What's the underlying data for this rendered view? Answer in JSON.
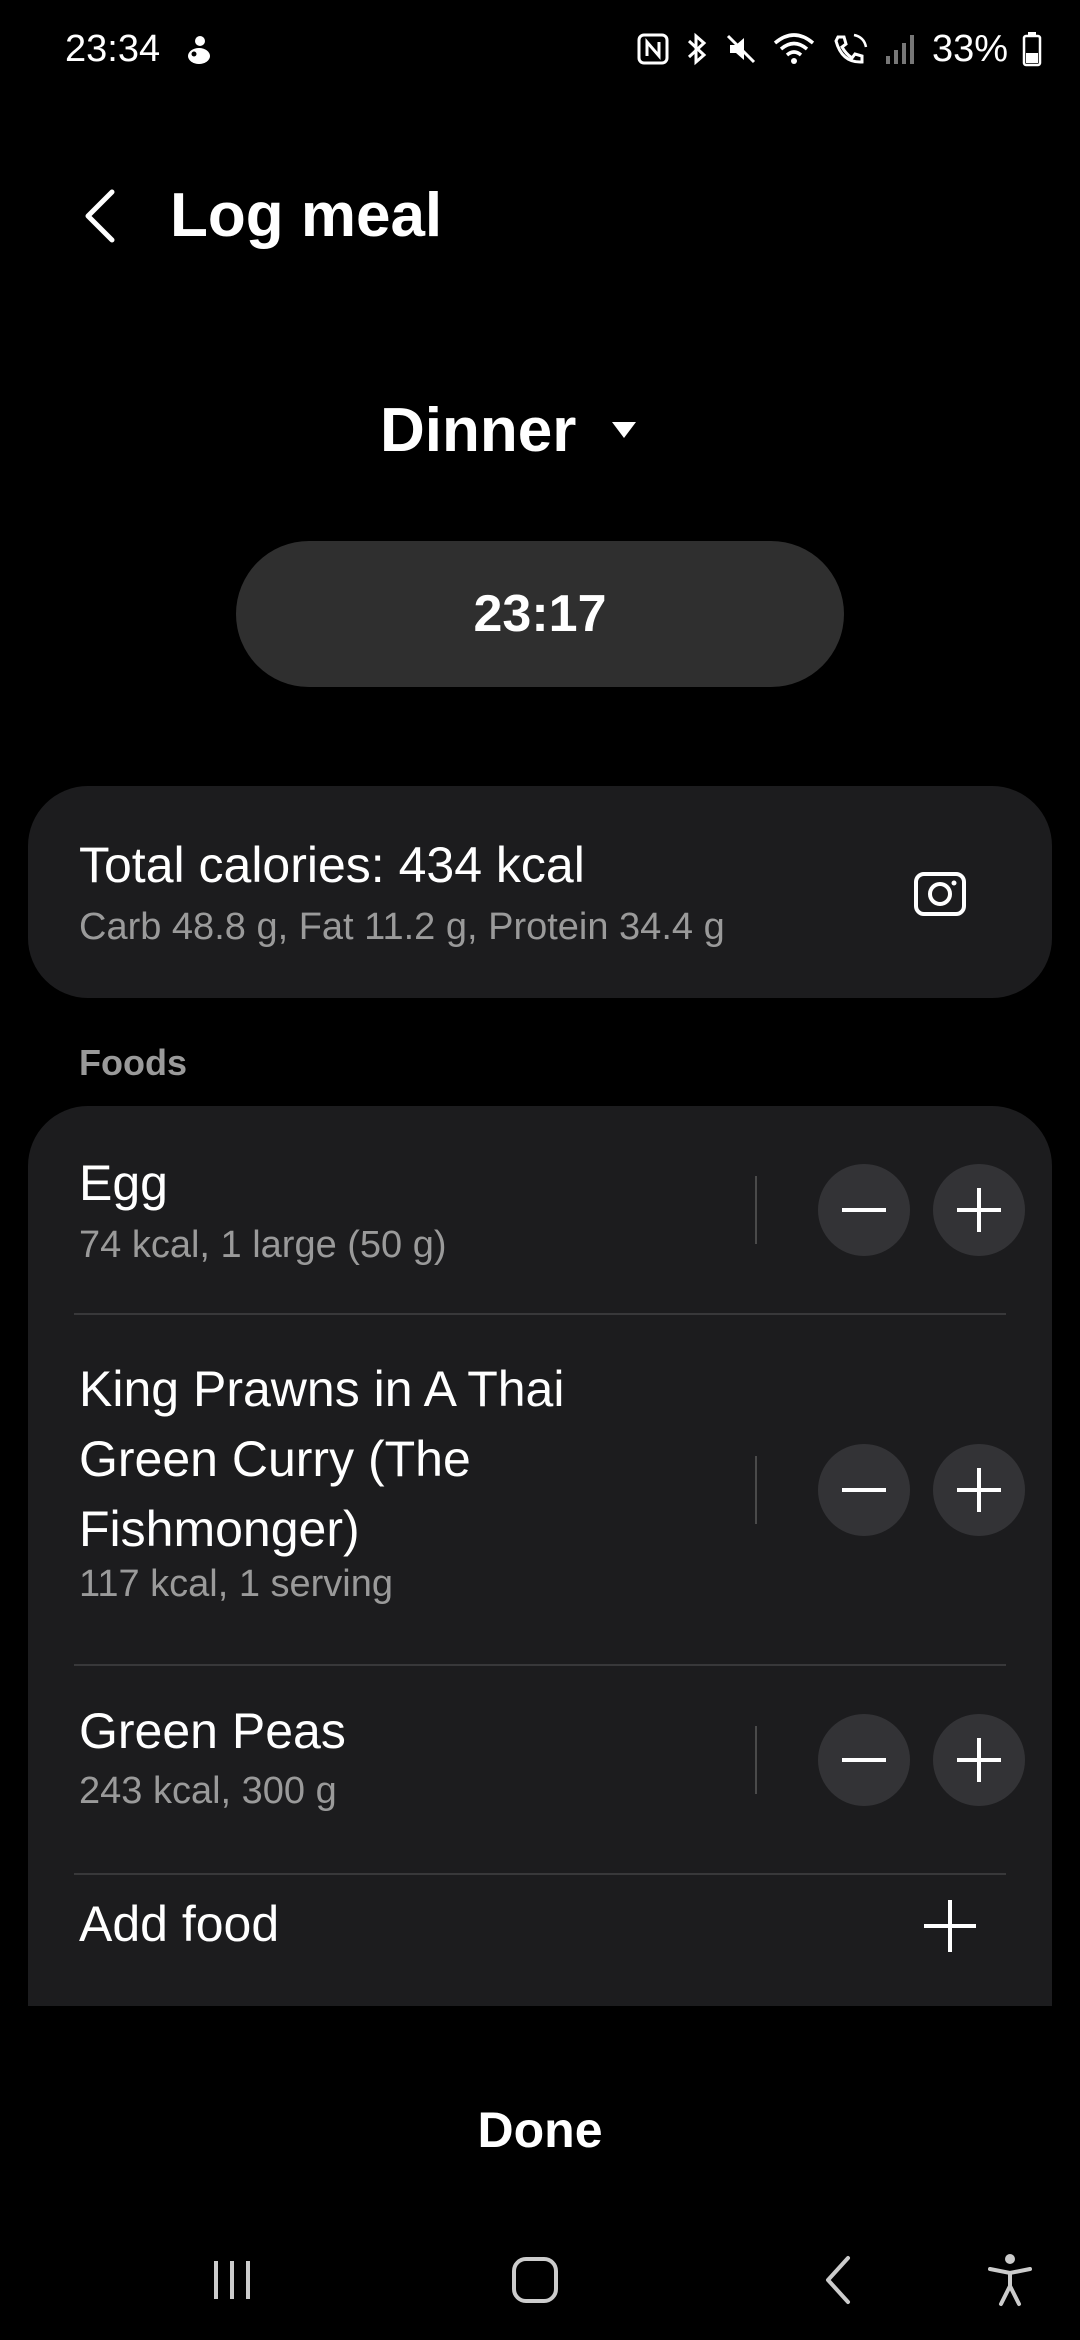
{
  "status_bar": {
    "time": "23:34",
    "battery": "33%",
    "icons": [
      "nfc-icon",
      "bluetooth-icon",
      "mute-icon",
      "wifi-icon",
      "wifi-calling-icon",
      "signal-icon",
      "battery-icon"
    ]
  },
  "header": {
    "title": "Log meal",
    "back_icon": "back-chevron-icon"
  },
  "meal": {
    "type": "Dinner",
    "time": "23:17"
  },
  "summary": {
    "total": "Total calories: 434 kcal",
    "macros": "Carb 48.8 g, Fat 11.2 g, Protein 34.4 g",
    "camera_icon": "camera-icon"
  },
  "foods": {
    "section_label": "Foods",
    "items": [
      {
        "name": "Egg",
        "detail": "74 kcal, 1 large (50 g)"
      },
      {
        "name": "King Prawns in A Thai Green Curry (The Fishmonger)",
        "detail": "117 kcal, 1 serving"
      },
      {
        "name": "Green Peas",
        "detail": "243 kcal, 300 g"
      }
    ],
    "add_label": "Add food"
  },
  "actions": {
    "done_label": "Done"
  },
  "nav": {
    "icons": [
      "recent-apps-icon",
      "home-icon",
      "back-icon",
      "accessibility-icon"
    ]
  },
  "colors": {
    "background": "#000000",
    "card": "#1c1c1e",
    "pill": "#2f2f2f",
    "secondary_text": "#9a9a9a"
  }
}
